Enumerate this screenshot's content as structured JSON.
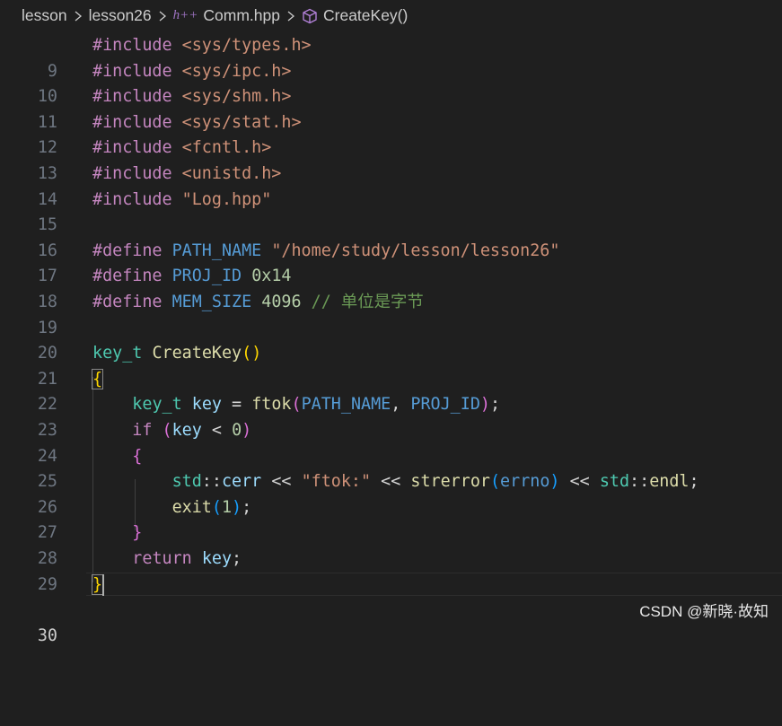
{
  "breadcrumb": {
    "items": [
      "lesson",
      "lesson26",
      "Comm.hpp",
      "CreateKey()"
    ],
    "file_icon": "h++"
  },
  "editor": {
    "line_numbers": [
      "9",
      "10",
      "11",
      "12",
      "13",
      "14",
      "15",
      "16",
      "17",
      "18",
      "19",
      "20",
      "21",
      "22",
      "23",
      "24",
      "25",
      "26",
      "27",
      "28",
      "29",
      "30"
    ],
    "active_line": "30",
    "tokens": {
      "include": "#include",
      "define": "#define",
      "inc_types": "<sys/types.h>",
      "inc_ipc": "<sys/ipc.h>",
      "inc_shm": "<sys/shm.h>",
      "inc_stat": "<sys/stat.h>",
      "inc_fcntl": "<fcntl.h>",
      "inc_unistd": "<unistd.h>",
      "inc_log": "\"Log.hpp\"",
      "path_name": "PATH_NAME",
      "path_value": "\"/home/study/lesson/lesson26\"",
      "proj_id": "PROJ_ID",
      "proj_value": "0x14",
      "mem_size": "MEM_SIZE",
      "mem_value": "4096",
      "mem_comment": "// 单位是字节",
      "key_t": "key_t",
      "create_key": "CreateKey",
      "lparen": "(",
      "rparen": ")",
      "lbrace": "{",
      "rbrace": "}",
      "key": "key",
      "eq": "=",
      "ftok": "ftok",
      "comma": ",",
      "semi": ";",
      "if": "if",
      "lt": "<",
      "zero": "0",
      "std": "std",
      "scope": "::",
      "cerr": "cerr",
      "shl": "<<",
      "ftok_str": "\"ftok:\"",
      "strerror": "strerror",
      "errno": "errno",
      "endl": "endl",
      "exit": "exit",
      "one": "1",
      "return": "return"
    }
  },
  "watermark": "CSDN @新晓·故知",
  "colors": {
    "background": "#1f1f1f",
    "preprocessor": "#c586c0",
    "string": "#ce9178",
    "macro": "#569cd6",
    "number": "#b5cea8",
    "comment": "#6a9955",
    "type": "#4ec9b0",
    "function": "#dcdcaa",
    "variable": "#9cdcfe"
  }
}
